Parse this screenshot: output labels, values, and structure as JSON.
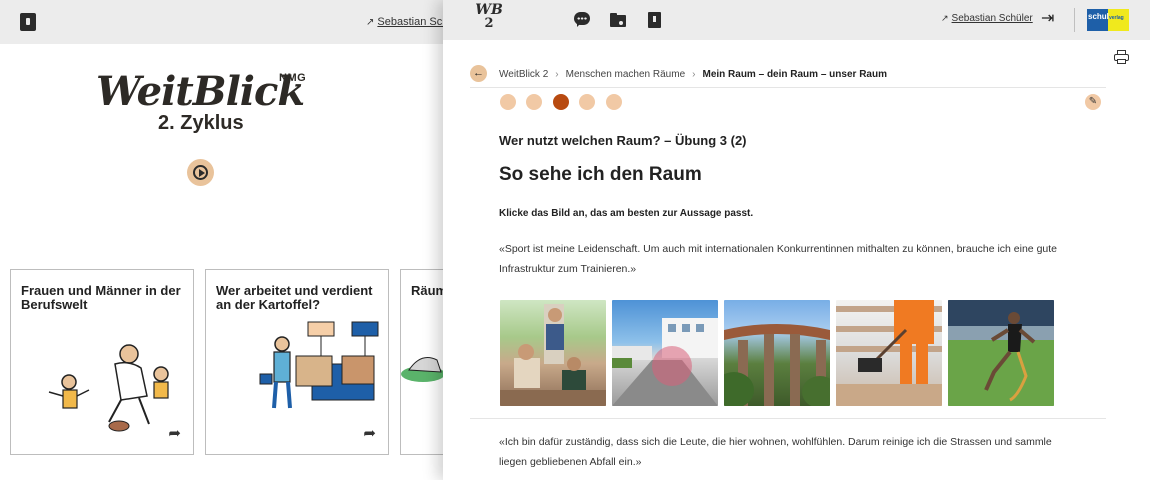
{
  "background_app": {
    "user_name": "Sebastian Schü",
    "logo_text": "WeitBlick",
    "logo_superscript": "NMG",
    "logo_subtitle": "2. Zyklus",
    "cards": [
      {
        "title": "Frauen und Männer in der Berufswelt"
      },
      {
        "title": "Wer arbeitet und verdient an der Kartoffel?"
      },
      {
        "title": "Räum"
      }
    ]
  },
  "panel": {
    "topbar": {
      "logo_top": "WB",
      "logo_num": "2",
      "user_name": "Sebastian Schüler",
      "brand_logo_text": "schul",
      "brand_logo_sub": "verlag"
    },
    "breadcrumb": [
      "WeitBlick 2",
      "Menschen machen Räume",
      "Mein Raum – dein Raum – unser Raum"
    ],
    "steps": {
      "count": 5,
      "active_index": 2
    },
    "exercise": {
      "subtitle": "Wer nutzt welchen Raum? – Übung 3 (2)",
      "title": "So sehe ich den Raum",
      "instruction": "Klicke das Bild an, das am besten zur Aussage passt.",
      "quote1": "«Sport ist meine Leidenschaft. Um auch mit internationalen Konkurrentinnen mithalten zu können, brauche ich eine gute Infrastruktur zum Trainieren.»",
      "quote2": "«Ich bin dafür zuständig, dass sich die Leute, die hier wohnen, wohlfühlen. Darum reinige ich die Strassen und sammle liegen gebliebenen Abfall ein.»"
    },
    "photos": [
      {
        "name": "photo-family-stairs"
      },
      {
        "name": "photo-residential-street"
      },
      {
        "name": "photo-railway-viaduct"
      },
      {
        "name": "photo-snow-shoveling"
      },
      {
        "name": "photo-para-athlete"
      }
    ],
    "colors": {
      "accent_light": "#f1c9a5",
      "accent_active": "#b84a10",
      "topbar_bg": "#ececec"
    }
  }
}
